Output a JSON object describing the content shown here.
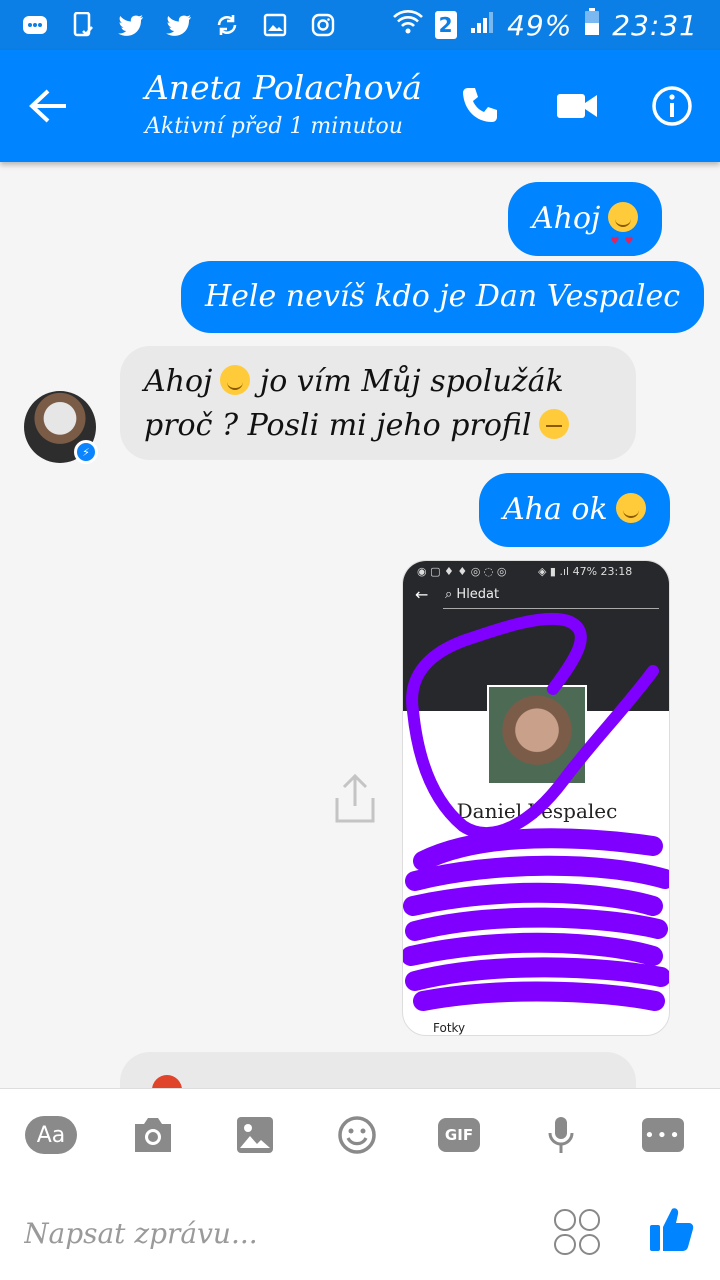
{
  "status_bar": {
    "battery": "49%",
    "time": "23:31",
    "sim": "2"
  },
  "header": {
    "contact_name": "Aneta Polachová",
    "status": "Aktivní před 1 minutou"
  },
  "messages": [
    {
      "from": "me",
      "text": "Ahoj",
      "emoji": "heart-eyes-emoji"
    },
    {
      "from": "me",
      "text": "Hele nevíš kdo je Dan Vespalec"
    },
    {
      "from": "them",
      "line1": "Ahoj",
      "line1b": "jo vím Můj spolužák",
      "line2": "proč ? Posli mi jeho profil"
    },
    {
      "from": "me",
      "text": "Aha ok"
    },
    {
      "from": "me",
      "type": "image"
    }
  ],
  "shared_image": {
    "status_text": "47% 23:18",
    "search_label": "Hledat",
    "profile_name": "Daniel Vespalec",
    "footer_label": "Fotky"
  },
  "compose": {
    "aa_label": "Aa",
    "gif_label": "GIF",
    "placeholder": "Napsat zprávu..."
  },
  "colors": {
    "status_bar": "#0c7fe6",
    "header": "#0084ff",
    "outgoing_bubble": "#0084ff",
    "incoming_bubble": "#e9e9e9",
    "scribble": "#8000ff"
  }
}
